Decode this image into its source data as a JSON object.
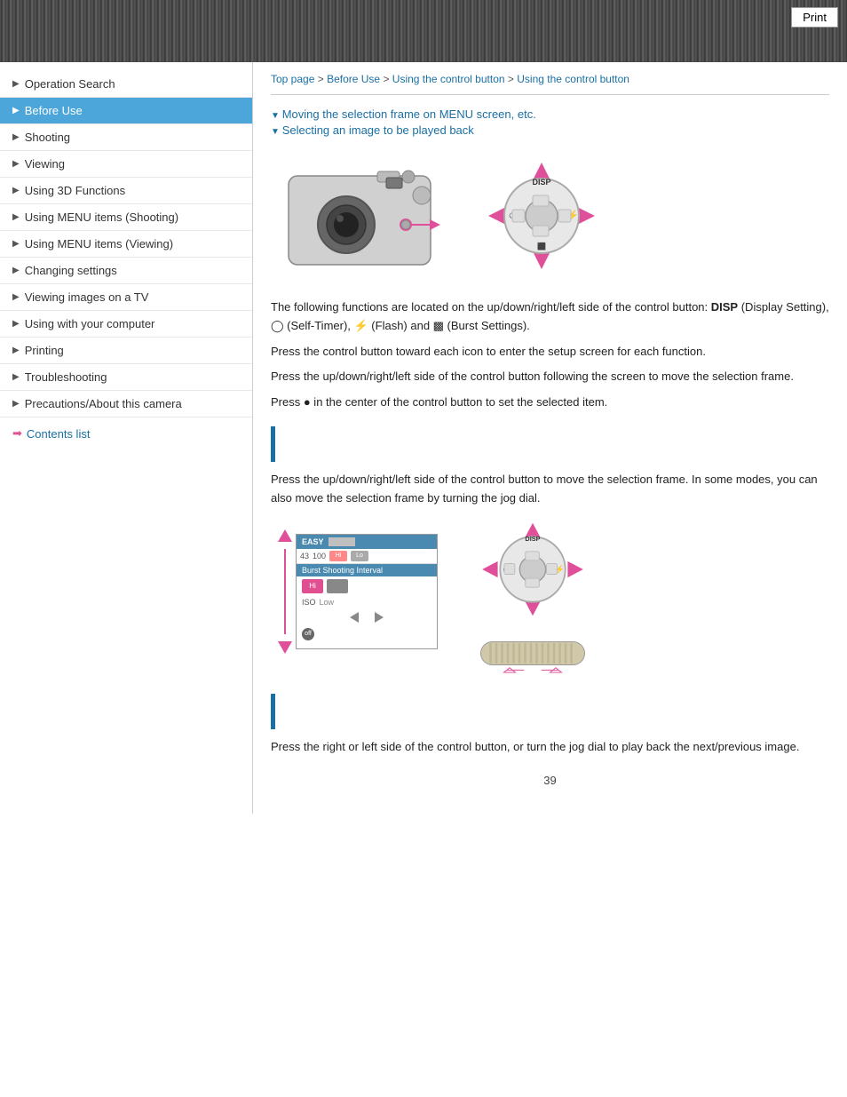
{
  "header": {
    "print_label": "Print"
  },
  "breadcrumb": {
    "top_page": "Top page",
    "before_use": "Before Use",
    "using_control_btn": "Using the control button",
    "using_control_btn2": "Using the control button",
    "separator": " > "
  },
  "sidebar": {
    "items": [
      {
        "label": "Operation Search",
        "active": false
      },
      {
        "label": "Before Use",
        "active": true
      },
      {
        "label": "Shooting",
        "active": false
      },
      {
        "label": "Viewing",
        "active": false
      },
      {
        "label": "Using 3D Functions",
        "active": false
      },
      {
        "label": "Using MENU items (Shooting)",
        "active": false
      },
      {
        "label": "Using MENU items (Viewing)",
        "active": false
      },
      {
        "label": "Changing settings",
        "active": false
      },
      {
        "label": "Viewing images on a TV",
        "active": false
      },
      {
        "label": "Using with your computer",
        "active": false
      },
      {
        "label": "Printing",
        "active": false
      },
      {
        "label": "Troubleshooting",
        "active": false
      },
      {
        "label": "Precautions/About this camera",
        "active": false
      }
    ],
    "contents_list": "Contents list"
  },
  "nav_links": {
    "link1": "Moving the selection frame on MENU screen, etc.",
    "link2": "Selecting an image to be played back"
  },
  "body": {
    "para1": "The following functions are located on the up/down/right/left side of the control button: DISP (Display Setting),  (Self-Timer),  (Flash) and  (Burst Settings).",
    "para2": "Press the control button toward each icon to enter the setup screen for each function.",
    "para3": "Press the up/down/right/left side of the control button following the screen to move the selection frame.",
    "para4": "Press  ● in the center of the control button to set the selected item.",
    "section1_para1": "Press the up/down/right/left side of the control button to move the selection frame. In some modes, you can also move the selection frame by turning the jog dial.",
    "section2_para1": "Press the right or left side of the control button, or turn the jog dial to play back the next/previous image."
  },
  "page_number": "39",
  "colors": {
    "accent_blue": "#1a6fa3",
    "accent_pink": "#e0509a",
    "sidebar_active": "#4da6d9"
  }
}
